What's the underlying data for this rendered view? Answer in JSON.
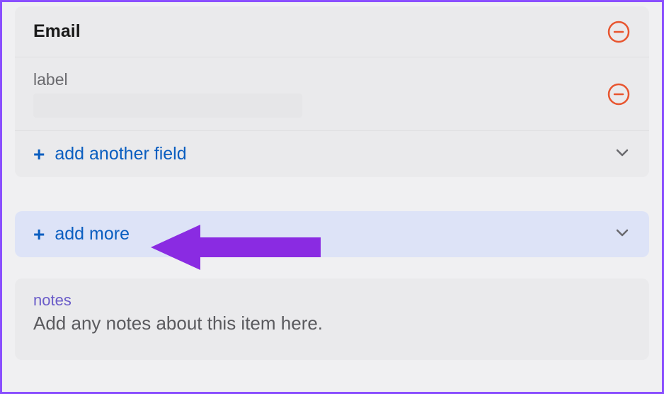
{
  "section": {
    "title": "Email",
    "field_label": "label",
    "add_field_label": "add another field"
  },
  "add_more_label": "add more",
  "notes": {
    "label": "notes",
    "placeholder": "Add any notes about this item here."
  },
  "colors": {
    "accent_blue": "#0a5ec0",
    "highlight_bg": "#dde3f7",
    "annotation_purple": "#8a2be2",
    "remove_stroke": "#e8552f",
    "notes_label": "#6a5cc9"
  }
}
